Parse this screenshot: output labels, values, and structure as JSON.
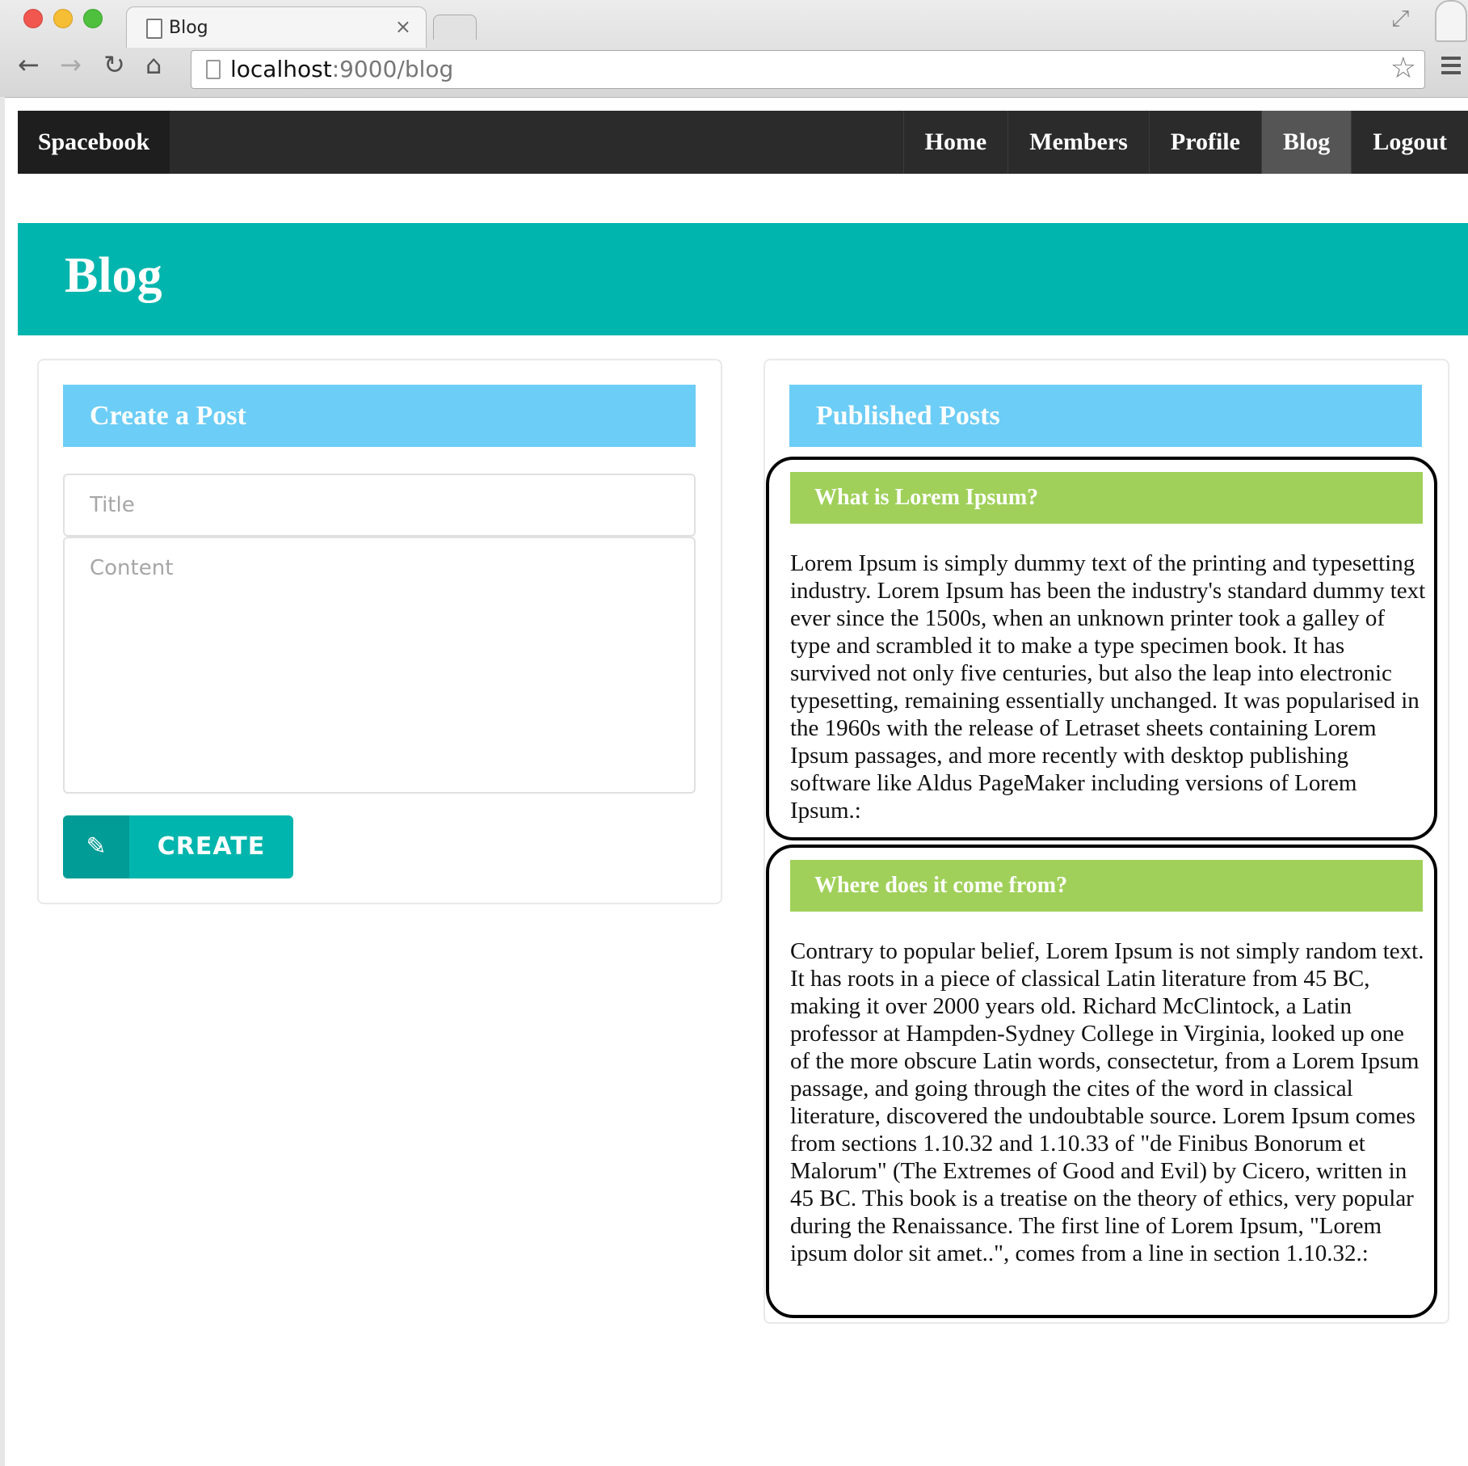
{
  "browser": {
    "tab_title": "Blog",
    "tab_close": "×",
    "url_host": "localhost",
    "url_rest": ":9000/blog"
  },
  "icons": {
    "back": "arrow-left-icon",
    "forward": "arrow-right-icon",
    "reload": "reload-icon",
    "home": "home-icon",
    "star": "star-icon",
    "menu": "hamburger-menu-icon",
    "edit": "edit-icon"
  },
  "navbar": {
    "brand": "Spacebook",
    "items": [
      {
        "label": "Home"
      },
      {
        "label": "Members"
      },
      {
        "label": "Profile"
      },
      {
        "label": "Blog",
        "active": true
      },
      {
        "label": "Logout"
      }
    ]
  },
  "hero": {
    "title": "Blog"
  },
  "create_panel": {
    "header": "Create a Post",
    "title_placeholder": "Title",
    "content_placeholder": "Content",
    "button_label": "CREATE"
  },
  "published_panel": {
    "header": "Published Posts",
    "posts": [
      {
        "title": "What is Lorem Ipsum?",
        "content": "Lorem Ipsum is simply dummy text of the printing and typesetting industry. Lorem Ipsum has been the industry's standard dummy text ever since the 1500s, when an unknown printer took a galley of type and scrambled it to make a type specimen book. It has survived not only five centuries, but also the leap into electronic typesetting, remaining essentially unchanged. It was popularised in the 1960s with the release of Letraset sheets containing Lorem Ipsum passages, and more recently with desktop publishing software like Aldus PageMaker including versions of Lorem Ipsum.:"
      },
      {
        "title": "Where does it come from?",
        "content": "Contrary to popular belief, Lorem Ipsum is not simply random text. It has roots in a piece of classical Latin literature from 45 BC, making it over 2000 years old. Richard McClintock, a Latin professor at Hampden-Sydney College in Virginia, looked up one of the more obscure Latin words, consectetur, from a Lorem Ipsum passage, and going through the cites of the word in classical literature, discovered the undoubtable source. Lorem Ipsum comes from sections 1.10.32 and 1.10.33 of \"de Finibus Bonorum et Malorum\" (The Extremes of Good and Evil) by Cicero, written in 45 BC. This book is a treatise on the theory of ethics, very popular during the Renaissance. The first line of Lorem Ipsum, \"Lorem ipsum dolor sit amet..\", comes from a line in section 1.10.32.:"
      }
    ]
  },
  "colors": {
    "navbar": "#2b2b2b",
    "hero": "#00b5ad",
    "panel_header": "#6ccdf6",
    "post_header": "#a0d05a",
    "create_button": "#00b5ad"
  }
}
